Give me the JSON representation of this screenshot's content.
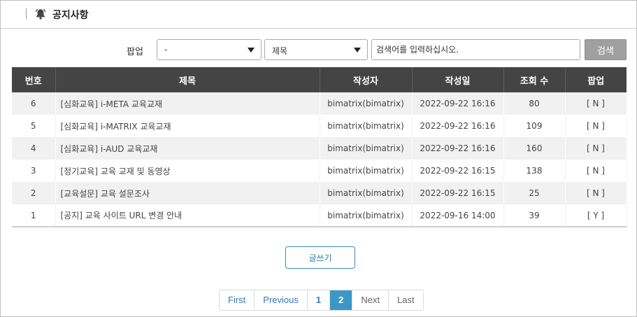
{
  "header": {
    "title": "공지사항",
    "icon": "bell-icon"
  },
  "filter": {
    "popup_label": "팝업",
    "popup_selected": "-",
    "field_selected": "제목",
    "search_placeholder": "검색어를 입력하십시오.",
    "search_button": "검색"
  },
  "table": {
    "columns": [
      "번호",
      "제목",
      "작성자",
      "작성일",
      "조회 수",
      "팝업"
    ],
    "rows": [
      {
        "no": "6",
        "title": "[심화교육] i-META 교육교재",
        "author": "bimatrix(bimatrix)",
        "date": "2022-09-22 16:16",
        "views": "80",
        "popup": "[ N ]"
      },
      {
        "no": "5",
        "title": "[심화교육] i-MATRIX 교육교재",
        "author": "bimatrix(bimatrix)",
        "date": "2022-09-22 16:16",
        "views": "109",
        "popup": "[ N ]"
      },
      {
        "no": "4",
        "title": "[심화교육] i-AUD 교육교재",
        "author": "bimatrix(bimatrix)",
        "date": "2022-09-22 16:16",
        "views": "160",
        "popup": "[ N ]"
      },
      {
        "no": "3",
        "title": "[정기교육] 교육 교재 및 동영상",
        "author": "bimatrix(bimatrix)",
        "date": "2022-09-22 16:15",
        "views": "138",
        "popup": "[ N ]"
      },
      {
        "no": "2",
        "title": "[교육설문] 교육 설문조사",
        "author": "bimatrix(bimatrix)",
        "date": "2022-09-22 16:15",
        "views": "25",
        "popup": "[ N ]"
      },
      {
        "no": "1",
        "title": "[공지] 교육 사이트 URL 변경 안내",
        "author": "bimatrix(bimatrix)",
        "date": "2022-09-16 14:00",
        "views": "39",
        "popup": "[ Y ]"
      }
    ]
  },
  "write_button": "글쓰기",
  "pagination": {
    "first": "First",
    "previous": "Previous",
    "pages": [
      "1",
      "2"
    ],
    "current": "2",
    "next": "Next",
    "last": "Last"
  },
  "colors": {
    "header_bg": "#444444",
    "accent": "#3b97c8",
    "row_alt": "#f1f1f1"
  }
}
